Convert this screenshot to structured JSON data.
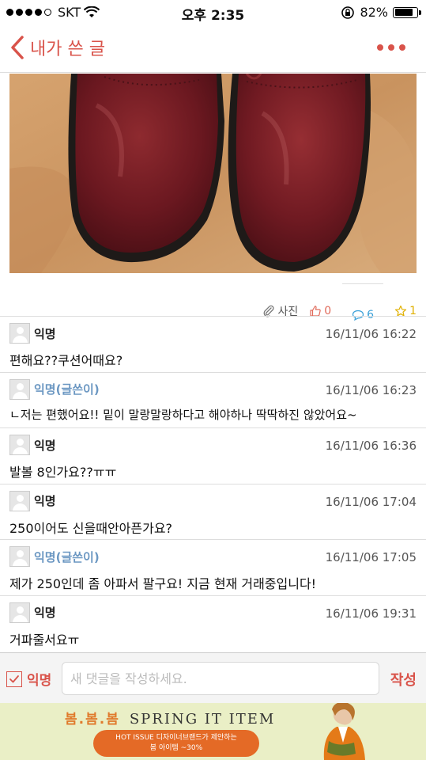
{
  "status_bar": {
    "carrier": "SKT",
    "time": "오후 2:35",
    "battery": "82%",
    "battery_level": 0.82
  },
  "nav": {
    "title": "내가 쓴 글"
  },
  "post_actions": {
    "photo_label": "사진",
    "likes": "0",
    "comments": "6",
    "scraps": "1"
  },
  "comments": [
    {
      "author": "익명",
      "is_author": false,
      "date": "16/11/06 16:22",
      "text": "편해요??쿠션어때요?"
    },
    {
      "author": "익명(글쓴이)",
      "is_author": true,
      "date": "16/11/06 16:23",
      "text": "ㄴ저는 편했어요!! 밑이 말랑말랑하다고 해야하나 딱딱하진 않았어요~"
    },
    {
      "author": "익명",
      "is_author": false,
      "date": "16/11/06 16:36",
      "text": "발볼 8인가요??ㅠㅠ"
    },
    {
      "author": "익명",
      "is_author": false,
      "date": "16/11/06 17:04",
      "text": "250이어도 신을때안아픈가요?"
    },
    {
      "author": "익명(글쓴이)",
      "is_author": true,
      "date": "16/11/06 17:05",
      "text": "제가 250인데 좀 아파서 팔구요! 지금 현재 거래중입니다!"
    },
    {
      "author": "익명",
      "is_author": false,
      "date": "16/11/06 19:31",
      "text": "거파줄서요ㅠ"
    }
  ],
  "input_bar": {
    "anonymous_label": "익명",
    "anonymous_checked": true,
    "placeholder": "새 댓글을 작성하세요.",
    "submit_label": "작성"
  },
  "ad_banner": {
    "headline_ko": "봄.봄.봄",
    "headline_en": "SPRING IT ITEM",
    "pill_line1": "HOT ISSUE 디자이너브랜드가 제안하는",
    "pill_line2": "봄 아이템 ~30%"
  },
  "colors": {
    "accent": "#d9534a",
    "author_name": "#6b97c2",
    "ad_background": "#eaefc6",
    "ad_orange": "#e46a26"
  }
}
